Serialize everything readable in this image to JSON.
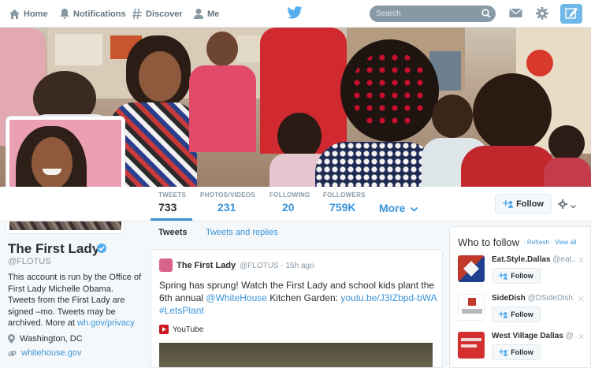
{
  "nav": {
    "items": [
      {
        "label": "Home",
        "icon": "home-icon"
      },
      {
        "label": "Notifications",
        "icon": "bell-icon"
      },
      {
        "label": "Discover",
        "icon": "hashtag-icon"
      },
      {
        "label": "Me",
        "icon": "person-icon"
      }
    ],
    "search_placeholder": "Search"
  },
  "colors": {
    "brand": "#55acee",
    "link": "#3b94d9",
    "text": "#292f33",
    "muted": "#8899a6"
  },
  "profile": {
    "name": "The First Lady",
    "handle": "@FLOTUS",
    "bio_text": "This account is run by the Office of First Lady Michelle Obama. Tweets from the First Lady are signed –mo. Tweets may be archived. More at",
    "bio_link": "wh.gov/privacy",
    "location": "Washington, DC",
    "website": "whitehouse.gov",
    "follow_label": "Follow"
  },
  "stats": [
    {
      "label": "TWEETS",
      "value": "733"
    },
    {
      "label": "PHOTOS/VIDEOS",
      "value": "231"
    },
    {
      "label": "FOLLOWING",
      "value": "20"
    },
    {
      "label": "FOLLOWERS",
      "value": "759K"
    }
  ],
  "more_label": "More",
  "timeline_tabs": [
    "Tweets",
    "Tweets and replies"
  ],
  "tweet": {
    "author": "The First Lady",
    "handle": "@FLOTUS",
    "time": "· 15h ago",
    "text_1": "Spring has sprung! Watch the First Lady and school kids plant the 6th annual",
    "mention": "@WhiteHouse",
    "text_2": "Kitchen Garden:",
    "url": "youtu.be/J3IZbpd-bWA",
    "hashtag": "#LetsPlant",
    "card_source": "YouTube"
  },
  "who_to_follow": {
    "title": "Who to follow",
    "refresh": "Refresh",
    "view_all": "View all",
    "follow_label": "Follow",
    "suggestions": [
      {
        "name": "Eat.Style.Dallas",
        "handle": "@eat...",
        "color": "#c0392b"
      },
      {
        "name": "SideDish",
        "handle": "@DSideDish",
        "color": "#ffffff"
      },
      {
        "name": "West Village Dallas",
        "handle": "@...",
        "color": "#d32f2f"
      }
    ]
  }
}
